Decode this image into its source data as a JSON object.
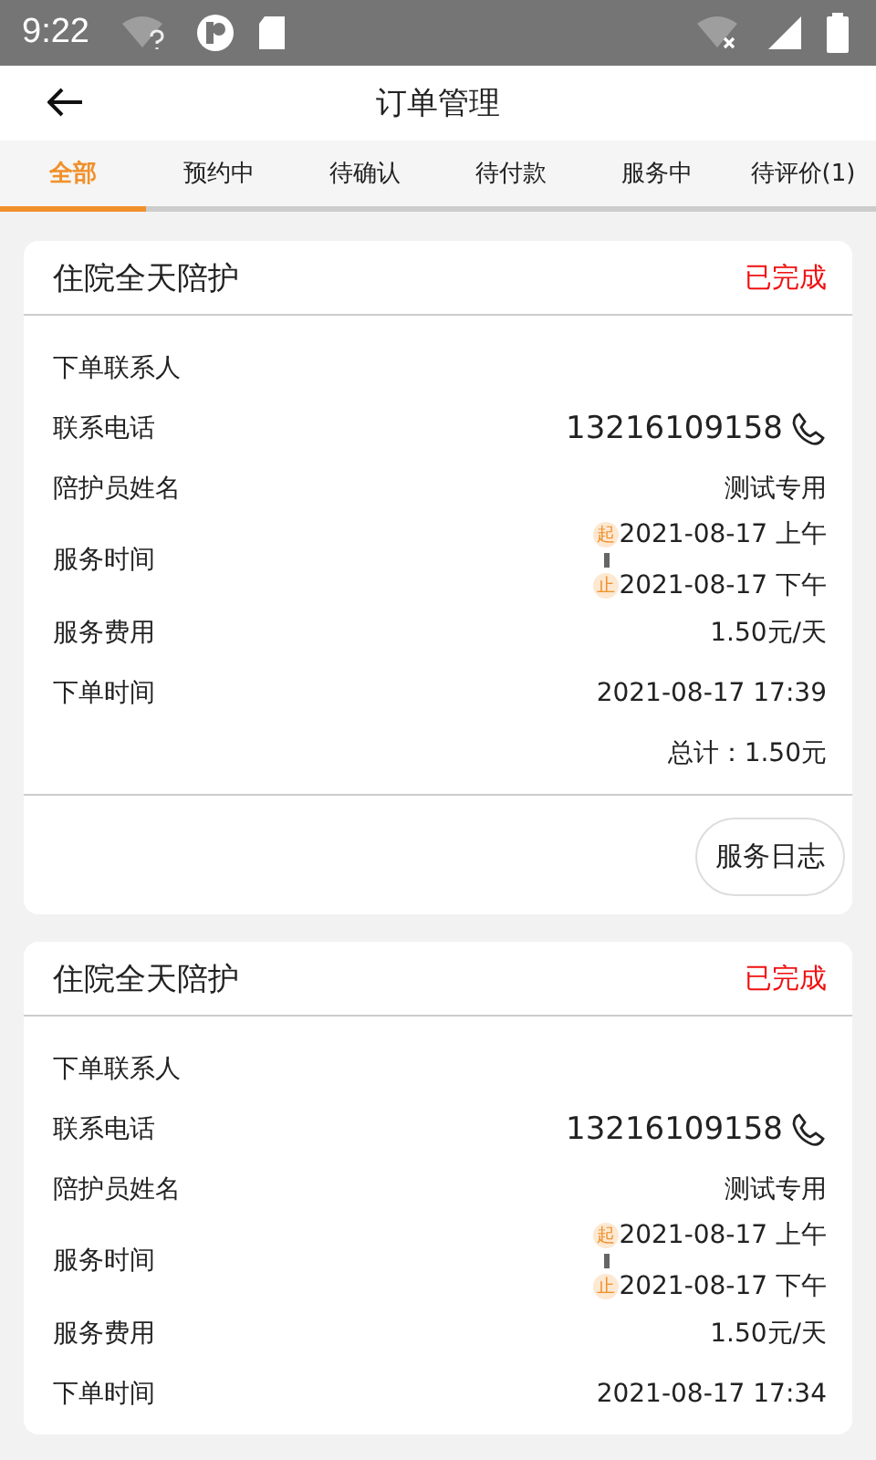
{
  "status_bar": {
    "time": "9:22"
  },
  "header": {
    "title": "订单管理"
  },
  "tabs": [
    {
      "label": "全部",
      "selected": true
    },
    {
      "label": "预约中",
      "selected": false
    },
    {
      "label": "待确认",
      "selected": false
    },
    {
      "label": "待付款",
      "selected": false
    },
    {
      "label": "服务中",
      "selected": false
    },
    {
      "label": "待评价(1)",
      "selected": false
    }
  ],
  "orders": [
    {
      "title": "住院全天陪护",
      "status": "已完成",
      "rows": [
        {
          "kind": "text",
          "label": "下单联系人"
        },
        {
          "kind": "phone",
          "label": "联系电话",
          "value": "13216109158"
        },
        {
          "kind": "text",
          "label": "陪护员姓名",
          "value": "测试专用"
        },
        {
          "kind": "range",
          "label": "服务时间",
          "start_tag": "起",
          "start": "2021-08-17 上午",
          "end_tag": "止",
          "end": "2021-08-17 下午"
        },
        {
          "kind": "text",
          "label": "服务费用",
          "value": "1.50元/天"
        },
        {
          "kind": "text",
          "label": "下单时间",
          "value": "2021-08-17 17:39"
        }
      ],
      "total": "总计：1.50元",
      "button": "服务日志"
    },
    {
      "title": "住院全天陪护",
      "status": "已完成",
      "rows": [
        {
          "kind": "text",
          "label": "下单联系人"
        },
        {
          "kind": "phone",
          "label": "联系电话",
          "value": "13216109158"
        },
        {
          "kind": "text",
          "label": "陪护员姓名",
          "value": "测试专用"
        },
        {
          "kind": "range",
          "label": "服务时间",
          "start_tag": "起",
          "start": "2021-08-17 上午",
          "end_tag": "止",
          "end": "2021-08-17 下午"
        },
        {
          "kind": "text",
          "label": "服务费用",
          "value": "1.50元/天"
        },
        {
          "kind": "text",
          "label": "下单时间",
          "value": "2021-08-17 17:34"
        }
      ]
    }
  ]
}
